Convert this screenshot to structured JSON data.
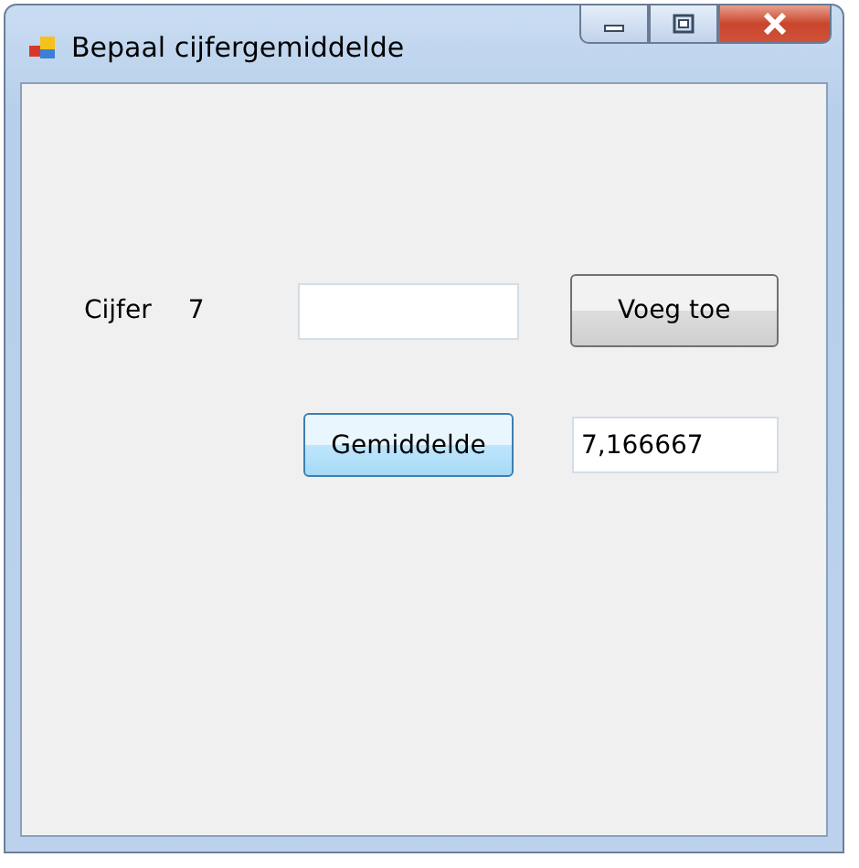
{
  "window": {
    "title": "Bepaal cijfergemiddelde"
  },
  "grade_label": "Cijfer",
  "grade_value": "7",
  "add_button": {
    "label": "Voeg toe",
    "focused": false
  },
  "average_button": {
    "label": "Gemiddelde",
    "focused": true
  },
  "average_output": {
    "value": "7,166667"
  }
}
